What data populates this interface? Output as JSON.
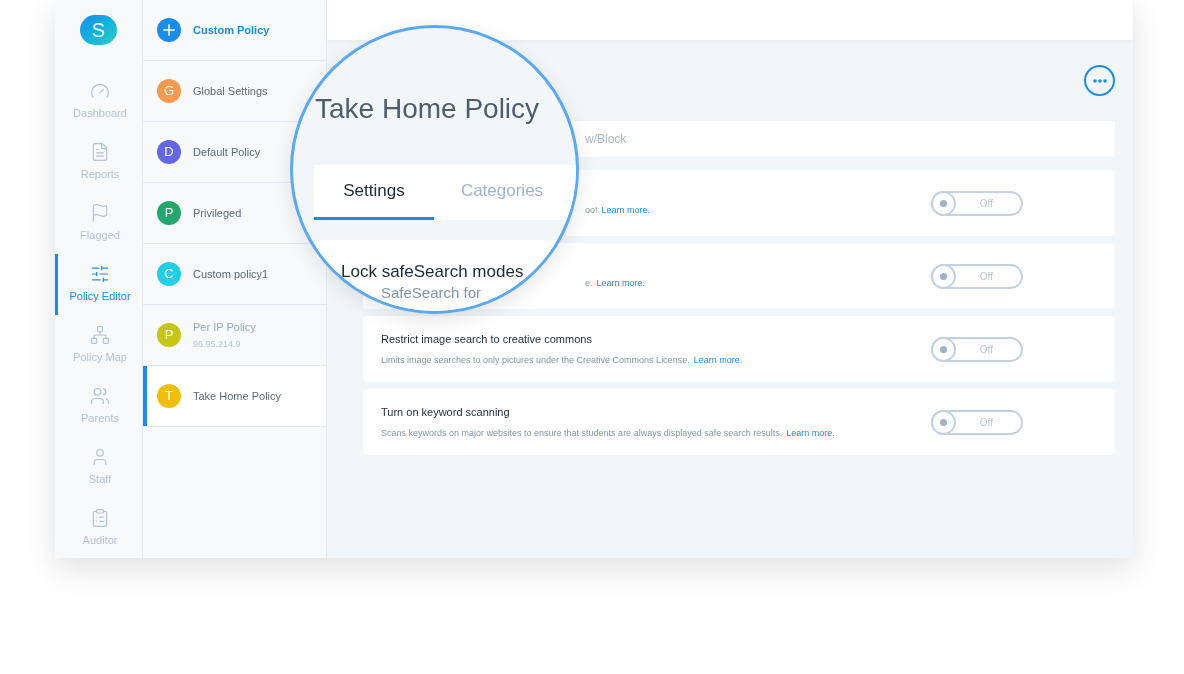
{
  "nav": {
    "avatar": "S",
    "items": [
      {
        "label": "Dashboard",
        "selected": false
      },
      {
        "label": "Reports",
        "selected": false
      },
      {
        "label": "Flagged",
        "selected": false
      },
      {
        "label": "Policy Editor",
        "selected": true
      },
      {
        "label": "Policy Map",
        "selected": false
      },
      {
        "label": "Parents",
        "selected": false
      },
      {
        "label": "Staff",
        "selected": false
      },
      {
        "label": "Auditor",
        "selected": false
      }
    ]
  },
  "policies": [
    {
      "kind": "add",
      "name": "Custom Policy",
      "selected": false
    },
    {
      "kind": "policy",
      "letter": "G",
      "name": "Global Settings",
      "color": "#f79a4f",
      "selected": false
    },
    {
      "kind": "policy",
      "letter": "D",
      "name": "Default Policy",
      "color": "#6366e8",
      "selected": false
    },
    {
      "kind": "policy",
      "letter": "P",
      "name": "Privileged",
      "color": "#22a86c",
      "selected": false
    },
    {
      "kind": "policy",
      "letter": "C",
      "name": "Custom policy1",
      "color": "#1fd0e6",
      "selected": false
    },
    {
      "kind": "policy",
      "letter": "P",
      "name": "Per IP Policy",
      "subtitle": "96.95.214.9",
      "color": "#c6c415",
      "selected": false
    },
    {
      "kind": "policy",
      "letter": "T",
      "name": "Take Home Policy",
      "color": "#f0bf0c",
      "selected": true
    }
  ],
  "settings": [
    {
      "kind": "partial",
      "text": "w/Block"
    },
    {
      "kind": "partial",
      "description": "oo!",
      "link": "Learn more.",
      "toggle": {
        "label": "Off",
        "on": false
      }
    },
    {
      "kind": "partial",
      "description": "e.",
      "link": "Learn more.",
      "toggle": {
        "label": "Off",
        "on": false
      }
    },
    {
      "kind": "full",
      "title": "Restrict image search to creative commons",
      "description": "Limits image searches to only pictures under the Creative Commons License.",
      "link": "Learn more.",
      "toggle": {
        "label": "Off",
        "on": false
      }
    },
    {
      "kind": "full",
      "title": "Turn on keyword scanning",
      "description": "Scans keywords on major websites to ensure that students are always displayed safe search results.",
      "link": "Learn more.",
      "toggle": {
        "label": "Off",
        "on": false
      }
    }
  ],
  "lens": {
    "title": "Take Home Policy",
    "tabs": [
      {
        "label": "Settings",
        "selected": true
      },
      {
        "label": "Categories",
        "selected": false
      }
    ],
    "setting_title": "Lock safeSearch modes",
    "setting_subtitle": "SafeSearch for"
  }
}
